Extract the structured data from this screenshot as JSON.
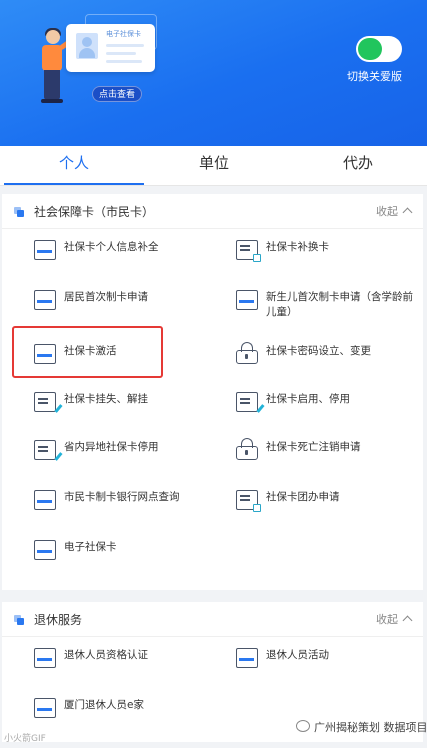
{
  "hero": {
    "card_title": "电子社保卡",
    "view_button": "点击查看",
    "toggle_label": "切换关爱版",
    "toggle_on": true
  },
  "tabs": [
    {
      "label": "个人",
      "active": true
    },
    {
      "label": "单位",
      "active": false
    },
    {
      "label": "代办",
      "active": false
    }
  ],
  "sections": [
    {
      "title": "社会保障卡（市民卡）",
      "collapse_label": "收起",
      "items": [
        {
          "label": "社保卡个人信息补全",
          "icon": "card-icon"
        },
        {
          "label": "社保卡补换卡",
          "icon": "document-icon"
        },
        {
          "label": "居民首次制卡申请",
          "icon": "card-icon"
        },
        {
          "label": "新生儿首次制卡申请（含学龄前儿童）",
          "icon": "card-icon"
        },
        {
          "label": "社保卡激活",
          "icon": "card-icon",
          "highlighted": true
        },
        {
          "label": "社保卡密码设立、变更",
          "icon": "lock-icon"
        },
        {
          "label": "社保卡挂失、解挂",
          "icon": "edit-card-icon"
        },
        {
          "label": "社保卡启用、停用",
          "icon": "edit-card-icon"
        },
        {
          "label": "省内异地社保卡停用",
          "icon": "edit-card-icon"
        },
        {
          "label": "社保卡死亡注销申请",
          "icon": "lock-icon"
        },
        {
          "label": "市民卡制卡银行网点查询",
          "icon": "card-icon"
        },
        {
          "label": "社保卡团办申请",
          "icon": "document-icon"
        },
        {
          "label": "电子社保卡",
          "icon": "card-icon"
        }
      ]
    },
    {
      "title": "退休服务",
      "collapse_label": "收起",
      "items": [
        {
          "label": "退休人员资格认证",
          "icon": "card-icon"
        },
        {
          "label": "退休人员活动",
          "icon": "card-icon"
        },
        {
          "label": "厦门退休人员e家",
          "icon": "card-icon"
        }
      ]
    }
  ],
  "watermark": "广州揭秘策划 数据项目",
  "corner_mark": "小火箭GIF",
  "colors": {
    "primary": "#1e6ff0",
    "hero_gradient_start": "#2f8cf6",
    "toggle_on": "#21c55d",
    "highlight_border": "#e53935"
  }
}
